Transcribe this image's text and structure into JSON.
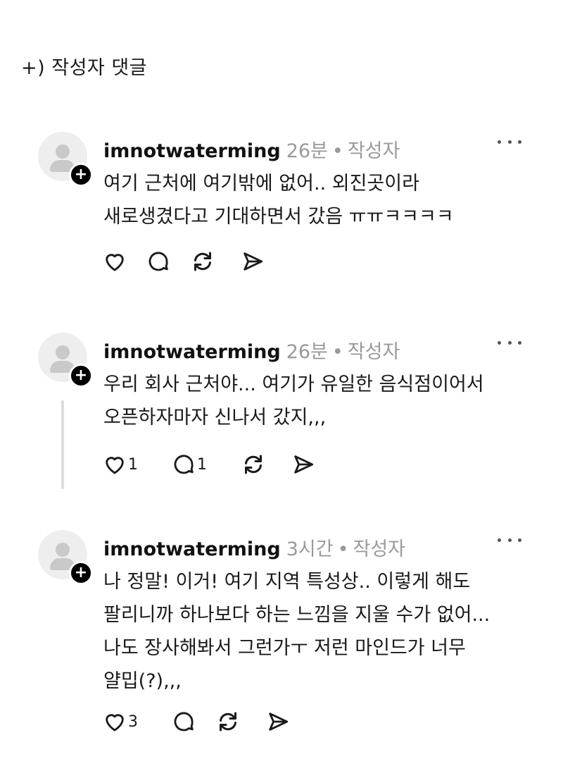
{
  "header_note": "+) 작성자 댓글",
  "comments": [
    {
      "username": "imnotwaterming",
      "time": "26분",
      "author_tag": "작성자",
      "lines": [
        "여기 근처에 여기밖에 없어.. 외진곳이라",
        "새로생겼다고 기대하면서 갔음 ㅠㅠㅋㅋㅋㅋ"
      ],
      "like_count": "",
      "reply_count": ""
    },
    {
      "username": "imnotwaterming",
      "time": "26분",
      "author_tag": "작성자",
      "lines": [
        "우리 회사 근처야... 여기가 유일한 음식점이어서",
        "오픈하자마자 신나서 갔지,,,"
      ],
      "like_count": "1",
      "reply_count": "1"
    },
    {
      "username": "imnotwaterming",
      "time": "3시간",
      "author_tag": "작성자",
      "lines": [
        "나 정말! 이거! 여기 지역 특성상.. 이렇게 해도",
        "팔리니까 하나보다 하는 느낌을 지울 수가 없어...",
        "나도 장사해봐서 그런가ㅜ 저런 마인드가 너무",
        "얄밉(?),,,"
      ],
      "like_count": "3",
      "reply_count": ""
    }
  ],
  "separator": "•",
  "icons": {
    "avatar": "default-avatar-icon",
    "badge": "plus-icon",
    "more": "more-dots-icon",
    "like": "heart-icon",
    "reply": "speech-bubble-icon",
    "repost": "repost-icon",
    "share": "send-icon"
  }
}
